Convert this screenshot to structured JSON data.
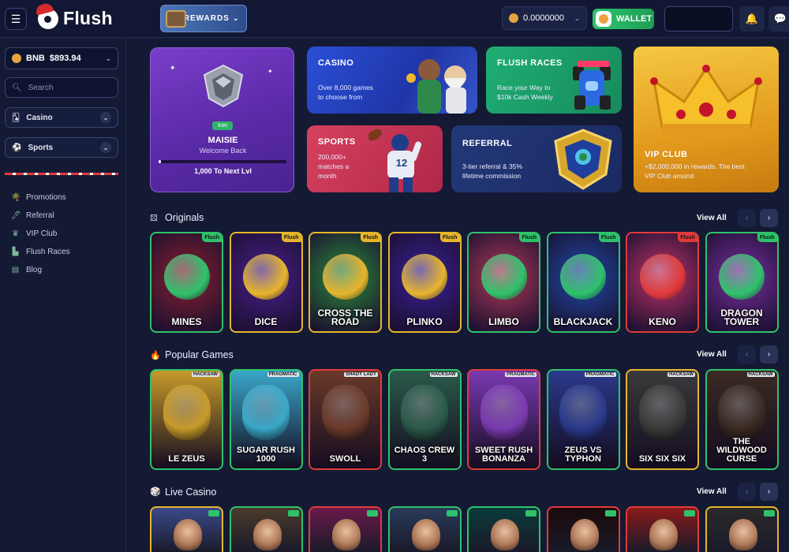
{
  "header": {
    "logo_text": "Flush",
    "rewards_label": "REWARDS ⌄",
    "balance": "0.0000000",
    "wallet_label": "WALLET"
  },
  "sidebar": {
    "bnb_label": "BNB",
    "bnb_amount": "$893.94",
    "search_placeholder": "Search",
    "casino_label": "Casino",
    "sports_label": "Sports",
    "links": [
      {
        "label": "Promotions",
        "icon": "promotions-icon"
      },
      {
        "label": "Referral",
        "icon": "referral-icon"
      },
      {
        "label": "VIP Club",
        "icon": "crown-icon"
      },
      {
        "label": "Flush Races",
        "icon": "podium-icon"
      },
      {
        "label": "Blog",
        "icon": "blog-icon"
      }
    ]
  },
  "profile": {
    "rank": "Iron",
    "username": "MAISIE",
    "welcome": "Welcome Back",
    "next_level": "1,000  To Next Lvl",
    "progress": 0.02
  },
  "banners": {
    "casino": {
      "title": "CASINO",
      "line1": "Over 8,000 games",
      "line2": "to choose from"
    },
    "races": {
      "title": "FLUSH RACES",
      "line1": "Race your Way to",
      "line2": "$10k Cash Weekly"
    },
    "sports": {
      "title": "SPORTS",
      "line1": "200,000+",
      "line2": "matches a",
      "line3": "month",
      "jersey": "12"
    },
    "referral": {
      "title": "REFERRAL",
      "line1": "3-tier referral & 35%",
      "line2": "lifetime commission"
    },
    "vip": {
      "title": "VIP CLUB",
      "line1": "+$2,000,000 in rewards. The best",
      "line2": "VIP Club around"
    }
  },
  "sections": {
    "originals": {
      "title": "Originals",
      "view_all": "View All"
    },
    "popular": {
      "title": "Popular Games",
      "view_all": "View All"
    },
    "live": {
      "title": "Live Casino",
      "view_all": "View All"
    }
  },
  "originals": [
    {
      "name": "MINES",
      "tag": "Flush",
      "border": "#2fc26b",
      "bg": "#8a1f2e",
      "tag_bg": "#2fc26b"
    },
    {
      "name": "DICE",
      "tag": "Flush",
      "border": "#e7b52c",
      "bg": "#4a1e8c",
      "tag_bg": "#e7b52c"
    },
    {
      "name": "CROSS THE ROAD",
      "tag": "Flush",
      "border": "#e7b52c",
      "bg": "#2b8a3a",
      "tag_bg": "#e7b52c"
    },
    {
      "name": "PLINKO",
      "tag": "Flush",
      "border": "#e7b52c",
      "bg": "#3a1f96",
      "tag_bg": "#e7b52c"
    },
    {
      "name": "LIMBO",
      "tag": "Flush",
      "border": "#2fc26b",
      "bg": "#b13a58",
      "tag_bg": "#2fc26b"
    },
    {
      "name": "BLACKJACK",
      "tag": "Flush",
      "border": "#2fc26b",
      "bg": "#1d4aa6",
      "tag_bg": "#2fc26b"
    },
    {
      "name": "KENO",
      "tag": "Flush",
      "border": "#e23a3a",
      "bg": "#c2336a",
      "tag_bg": "#e23a3a"
    },
    {
      "name": "DRAGON TOWER",
      "tag": "Flush",
      "border": "#2fc26b",
      "bg": "#7a2ea0",
      "tag_bg": "#2fc26b"
    }
  ],
  "popular": [
    {
      "name": "LE ZEUS",
      "prov": "HACKSAW",
      "border": "#2fc26b",
      "bg": "#c79a2a"
    },
    {
      "name": "SUGAR RUSH 1000",
      "prov": "PRAGMATIC",
      "border": "#2fc26b",
      "bg": "#3aa7c8"
    },
    {
      "name": "SWOLL",
      "prov": "SHADY LADY",
      "border": "#e23a3a",
      "bg": "#6a3a2a"
    },
    {
      "name": "CHAOS CREW 3",
      "prov": "HACKSAW",
      "border": "#2fc26b",
      "bg": "#2a5a4a"
    },
    {
      "name": "SWEET RUSH BONANZA",
      "prov": "PRAGMATIC",
      "border": "#e23a3a",
      "bg": "#7a3ab0"
    },
    {
      "name": "ZEUS VS TYPHON",
      "prov": "PRAGMATIC",
      "border": "#2fc26b",
      "bg": "#2a3a8a"
    },
    {
      "name": "SIX SIX SIX",
      "prov": "HACKSAW",
      "border": "#e7b52c",
      "bg": "#3a3a3a"
    },
    {
      "name": "THE WILDWOOD CURSE",
      "prov": "HACKSAW",
      "border": "#2fc26b",
      "bg": "#3a2a22"
    }
  ],
  "live": [
    {
      "border": "#e7b52c",
      "bg": "#3a4a8a"
    },
    {
      "border": "#2fc26b",
      "bg": "#4a3a2a"
    },
    {
      "border": "#e23a3a",
      "bg": "#6a1a4a"
    },
    {
      "border": "#2fc26b",
      "bg": "#2a3a5a"
    },
    {
      "border": "#2fc26b",
      "bg": "#0a3a3a"
    },
    {
      "border": "#e23a3a",
      "bg": "#1a0a0a"
    },
    {
      "border": "#e23a3a",
      "bg": "#8a1a1a"
    },
    {
      "border": "#e7b52c",
      "bg": "#2a2a2a"
    }
  ]
}
